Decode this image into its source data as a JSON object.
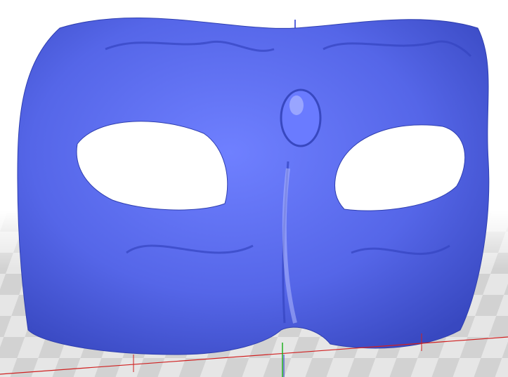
{
  "viewport": {
    "model_color": "#5566e8",
    "model_shadow": "#2f3fb0",
    "model_highlight": "#b9c2ff",
    "floor_light": "#e6e6e6",
    "floor_dark": "#cfcfcf",
    "x_axis_color": "#d02020",
    "y_axis_color": "#20b020",
    "z_axis_color": "#2030d0"
  }
}
